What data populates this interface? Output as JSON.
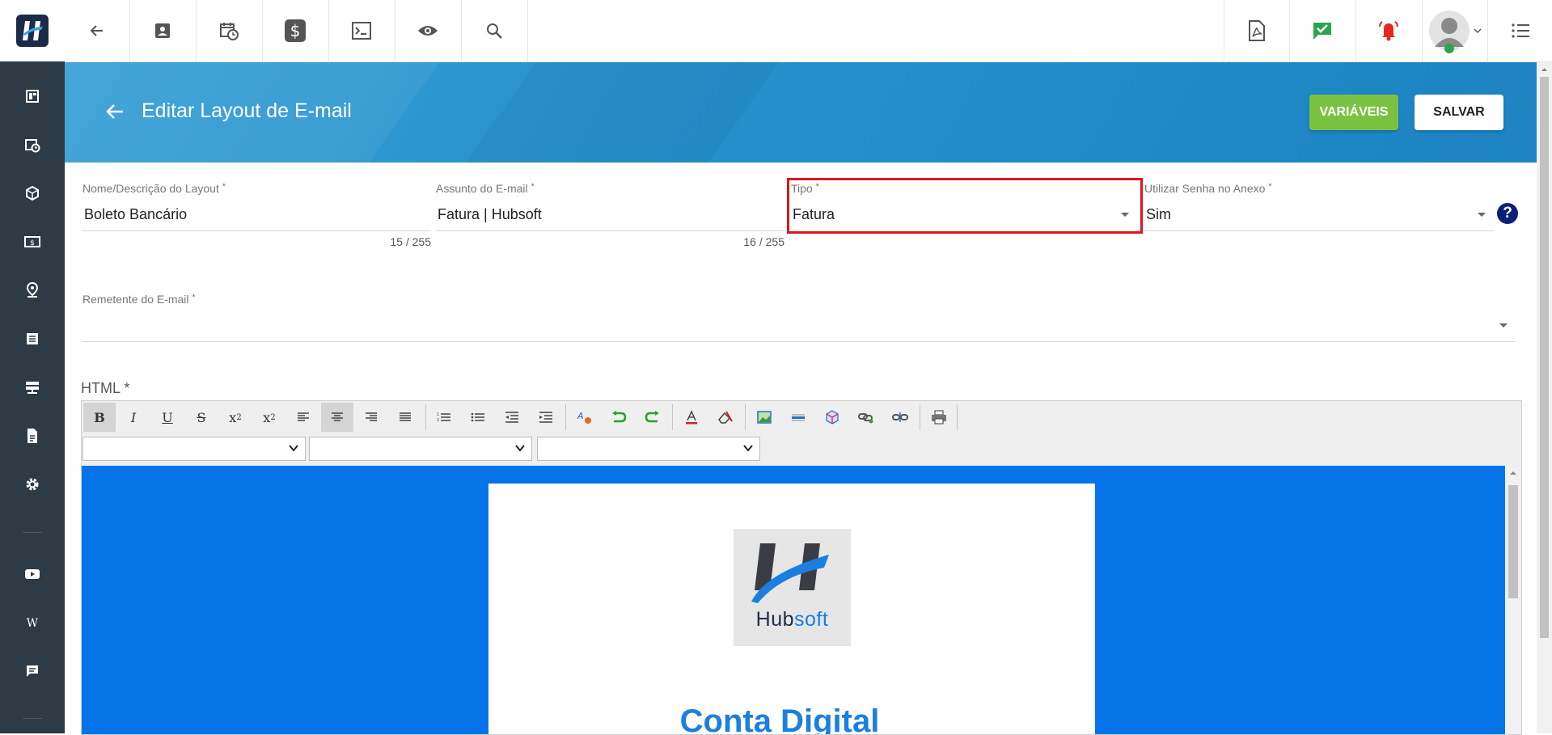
{
  "topbar": {
    "icons": [
      "back-arrow-icon",
      "contact-card-icon",
      "calendar-clock-icon",
      "dollar-icon",
      "terminal-icon",
      "eye-icon",
      "search-icon",
      "pdf-icon",
      "chat-check-icon",
      "alarm-bell-icon",
      "user-avatar-icon",
      "chevron-down-icon",
      "menu-list-icon"
    ]
  },
  "sidebar": {
    "icons": [
      "dashboard-icon",
      "calendar-clock-icon",
      "box-icon",
      "money-icon",
      "location-pin-icon",
      "list-icon",
      "server-icon",
      "document-icon",
      "settings-icon",
      "youtube-icon",
      "wikipedia-icon",
      "chat-icon"
    ]
  },
  "header": {
    "title": "Editar Layout de E-mail",
    "variables_label": "VARIÁVEIS",
    "save_label": "SALVAR"
  },
  "form": {
    "layout_name": {
      "label": "Nome/Descrição do Layout",
      "value": "Boleto Bancário",
      "counter": "15 / 255"
    },
    "subject": {
      "label": "Assunto do E-mail",
      "value": "Fatura | Hubsoft",
      "counter": "16 / 255"
    },
    "type": {
      "label": "Tipo",
      "value": "Fatura"
    },
    "password": {
      "label": "Utilizar Senha no Anexo",
      "value": "Sim"
    },
    "sender": {
      "label": "Remetente do E-mail",
      "value": ""
    },
    "required_mark": "*",
    "help_symbol": "?"
  },
  "editor": {
    "label": "HTML *",
    "tools": {
      "bold": "B",
      "italic": "I",
      "underline": "U",
      "strike": "S",
      "subscript": "x",
      "subscript_sub": "2",
      "superscript": "x",
      "superscript_sup": "2"
    },
    "content": {
      "logo_brand_dark": "Hub",
      "logo_brand_light": "soft",
      "heading": "Conta Digital"
    }
  },
  "colors": {
    "header_blue": "#2690cc",
    "accent_green": "#7cc242",
    "highlight_red": "#e0141e",
    "canvas_blue": "#0574e8"
  }
}
